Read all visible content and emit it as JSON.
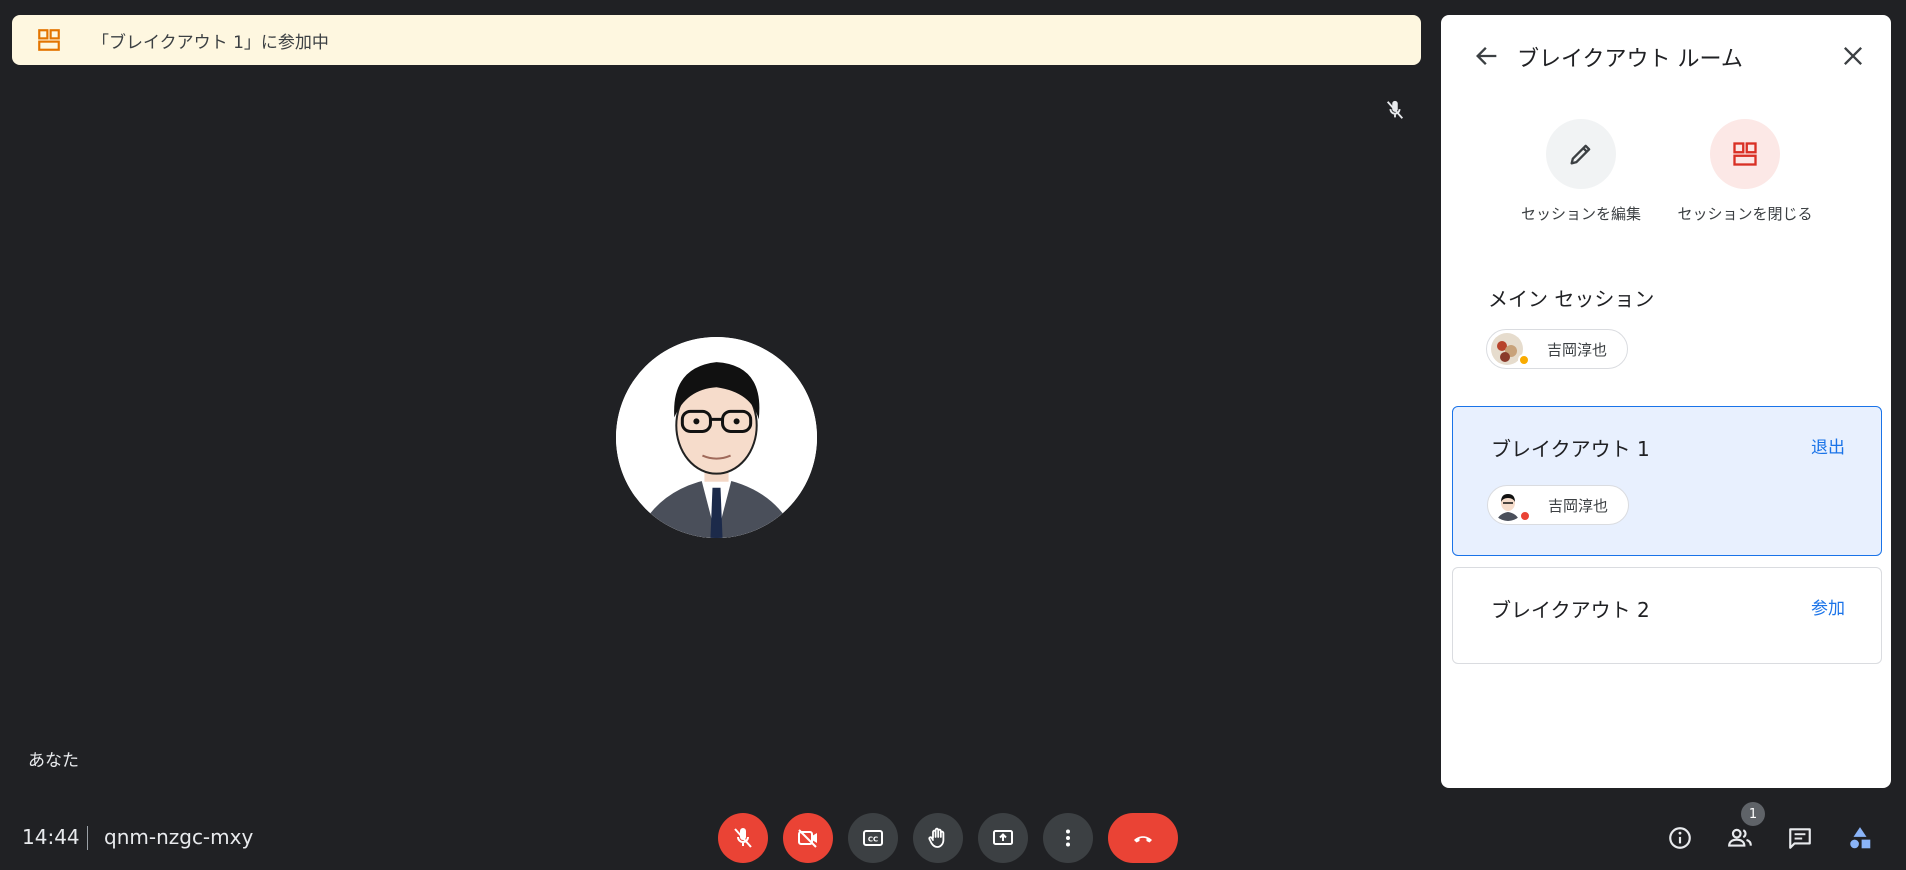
{
  "banner": {
    "text": "「ブレイクアウト 1」に参加中",
    "icon": "breakout-icon"
  },
  "stage": {
    "self_label": "あなた"
  },
  "bottom_bar": {
    "time": "14:44",
    "meeting_code": "qnm-nzgc-mxy",
    "people_count": "1"
  },
  "panel": {
    "title": "ブレイクアウト ルーム",
    "edit_label": "セッションを編集",
    "close_session_label": "セッションを閉じる",
    "main_session": {
      "title": "メイン セッション",
      "participant": "吉岡淳也"
    },
    "rooms": [
      {
        "name": "ブレイクアウト 1",
        "action": "退出",
        "participant": "吉岡淳也"
      },
      {
        "name": "ブレイクアウト 2",
        "action": "参加"
      }
    ]
  },
  "colors": {
    "background": "#202124",
    "banner": "#fef7e0",
    "accent": "#1a73e8",
    "danger": "#ea4335",
    "active_room": "#e8f0fe"
  }
}
